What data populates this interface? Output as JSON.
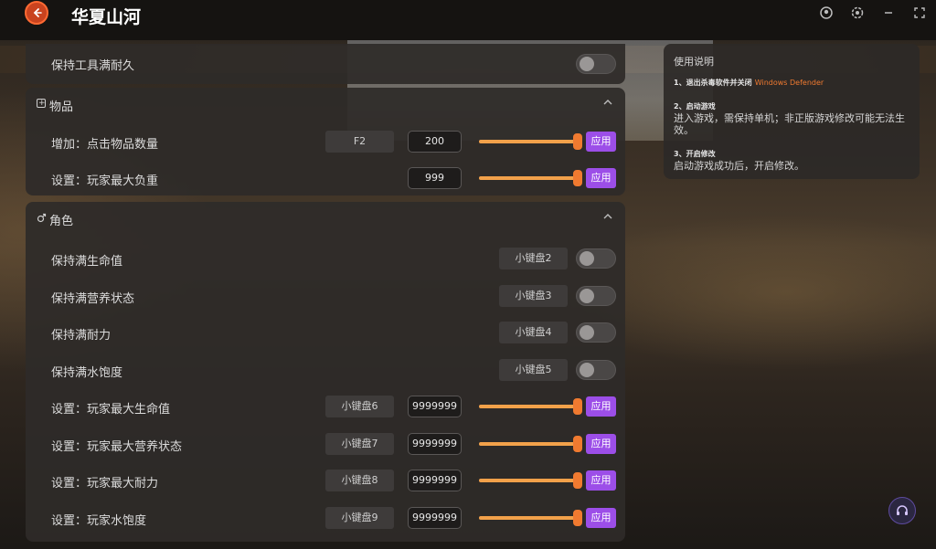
{
  "app": {
    "title": "华夏山河"
  },
  "titlebar": {
    "back_icon": "arrow-left-icon",
    "controls": [
      "user-icon",
      "settings-icon",
      "minimize-icon",
      "expand-icon"
    ]
  },
  "top_row": {
    "label": "保持工具满耐久",
    "toggle_on": false
  },
  "items_section": {
    "title": "物品",
    "rows": [
      {
        "label": "增加：点击物品数量",
        "hotkey": "F2",
        "value": "200",
        "slider_level": 1.0,
        "apply": "应用"
      },
      {
        "label": "设置：玩家最大负重",
        "value": "999",
        "slider_level": 1.0,
        "apply": "应用"
      }
    ]
  },
  "character_section": {
    "title": "角色",
    "toggle_rows": [
      {
        "label": "保持满生命值",
        "hotkey": "小键盘2",
        "on": false
      },
      {
        "label": "保持满营养状态",
        "hotkey": "小键盘3",
        "on": false
      },
      {
        "label": "保持满耐力",
        "hotkey": "小键盘4",
        "on": false
      },
      {
        "label": "保持满水饱度",
        "hotkey": "小键盘5",
        "on": false
      }
    ],
    "value_rows": [
      {
        "label": "设置：玩家最大生命值",
        "hotkey": "小键盘6",
        "value": "9999999",
        "slider_level": 1.0,
        "apply": "应用"
      },
      {
        "label": "设置：玩家最大营养状态",
        "hotkey": "小键盘7",
        "value": "9999999",
        "slider_level": 1.0,
        "apply": "应用"
      },
      {
        "label": "设置：玩家最大耐力",
        "hotkey": "小键盘8",
        "value": "9999999",
        "slider_level": 1.0,
        "apply": "应用"
      },
      {
        "label": "设置：玩家水饱度",
        "hotkey": "小键盘9",
        "value": "9999999",
        "slider_level": 1.0,
        "apply": "应用"
      }
    ]
  },
  "help": {
    "title": "使用说明",
    "step1_head": "1、退出杀毒软件并关闭",
    "step1_accent": "Windows Defender",
    "step2_head": "2、启动游戏",
    "step2_body": "进入游戏，需保持单机；非正版游戏修改可能无法生效。",
    "step3_head": "3、开启修改",
    "step3_body": "启动游戏成功后，开启修改。"
  },
  "colors": {
    "accent": "#9c4ee8",
    "slider": "#f2a14a",
    "brand": "#c9431f"
  }
}
